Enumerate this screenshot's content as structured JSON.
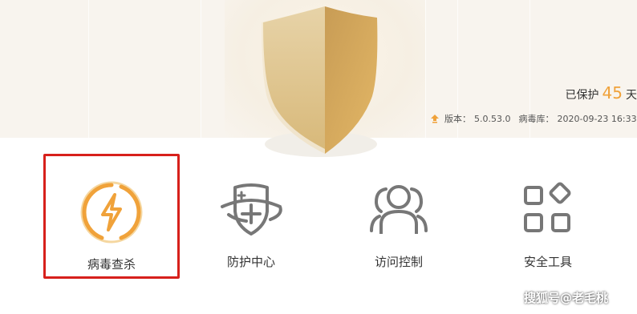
{
  "hero": {
    "protect_prefix": "已保护",
    "protect_days": "45",
    "protect_suffix": "天",
    "version_label": "版本：",
    "version_value": "5.0.53.0",
    "virus_db_label": "病毒库：",
    "virus_db_value": "2020-09-23 16:33"
  },
  "tiles": [
    {
      "label": "病毒查杀",
      "icon": "lightning-icon",
      "selected": true
    },
    {
      "label": "防护中心",
      "icon": "shield-plus-icon",
      "selected": false
    },
    {
      "label": "访问控制",
      "icon": "users-icon",
      "selected": false
    },
    {
      "label": "安全工具",
      "icon": "tools-grid-icon",
      "selected": false
    }
  ],
  "colors": {
    "accent": "#f0a23a",
    "selection": "#d7201b",
    "icon_gray": "#777777",
    "hero_bg": "#f8f4ee"
  },
  "watermark": "搜狐号@老毛桃"
}
